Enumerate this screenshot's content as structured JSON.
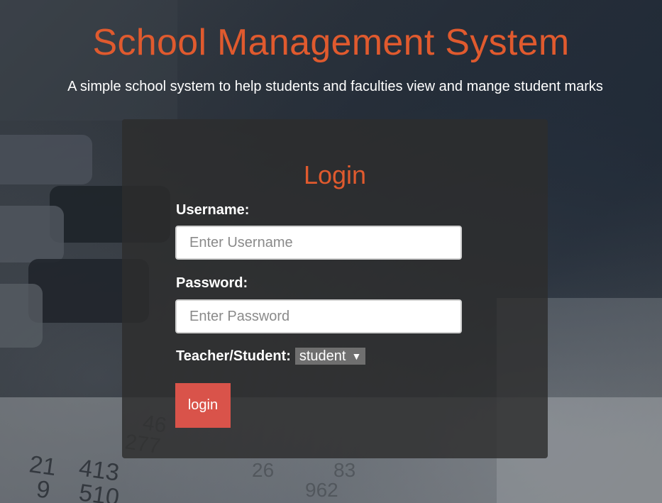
{
  "header": {
    "title": "School Management System",
    "subtitle": "A simple school system to help students and faculties view and mange student marks"
  },
  "login": {
    "title": "Login",
    "username_label": "Username:",
    "username_placeholder": "Enter Username",
    "password_label": "Password:",
    "password_placeholder": "Enter Password",
    "role_label": "Teacher/Student:",
    "role_selected": "student",
    "button_label": "login"
  },
  "colors": {
    "accent": "#e05a2e",
    "button": "#d9534a",
    "panel": "#2d2d2d"
  },
  "background": {
    "digits": [
      "277",
      "46",
      "21",
      "413",
      "9",
      "510",
      "26",
      "962",
      "83"
    ]
  },
  "icons": {
    "role_dropdown": "chevron-down-icon"
  }
}
